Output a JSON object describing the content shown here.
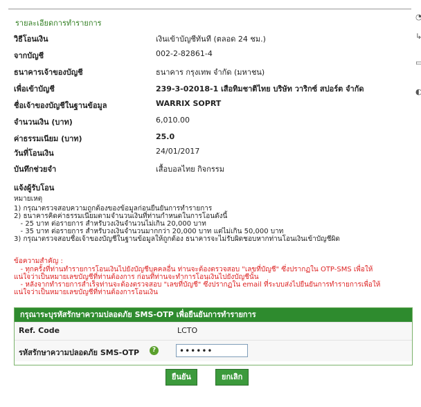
{
  "section_title": "รายละเอียดการทำรายการ",
  "rows": [
    {
      "label": "วิธีโอนเงิน",
      "value": "เงินเข้าบัญชีทันที (ตลอด 24 ชม.)",
      "bold": false
    },
    {
      "label": "จากบัญชี",
      "value": "002-2-82861-4",
      "bold": false
    },
    {
      "label": "ธนาคารเจ้าของบัญชี",
      "value": "ธนาคาร กรุงเทพ จำกัด (มหาชน)",
      "bold": false
    },
    {
      "label": "เพื่อเข้าบัญชี",
      "value": "239-3-02018-1 เสือทิมชาติไทย บริษัท วาริกซ์ สปอร์ต จำกัด",
      "bold": true
    },
    {
      "label": "ชื่อเจ้าของบัญชีในฐานข้อมูล",
      "value": "WARRIX SOPRT",
      "bold": true
    },
    {
      "label": "จำนวนเงิน (บาท)",
      "value": "6,010.00",
      "bold": false
    },
    {
      "label": "ค่าธรรมเนียม (บาท)",
      "value": "25.0",
      "bold": true
    },
    {
      "label": "วันที่โอนเงิน",
      "value": "24/01/2017",
      "bold": false
    },
    {
      "label": "บันทึกช่วยจำ",
      "value": "เสื้อบอลไทย กิจกรรม",
      "bold": false
    },
    {
      "label": "แจ้งผู้รับโอน",
      "value": "",
      "bold": false
    }
  ],
  "notes_title": "หมายเหตุ",
  "notes": [
    "1) กรุณาตรวจสอบความถูกต้องของข้อมูลก่อนยืนยันการทำรายการ",
    "2) ธนาคารคิดค่าธรรมเนียมตามจำนวนเงินที่ท่านกำหนดในการโอนดังนี้",
    "   - 25 บาท ต่อรายการ สำหรับวงเงินจำนวนไม่เกิน 20,000 บาท",
    "   - 35 บาท ต่อรายการ สำหรับวงเงินจำนวนมากกว่า 20,000 บาท แต่ไม่เกิน 50,000 บาท",
    "3) กรุณาตรวจสอบชื่อเจ้าของบัญชีในฐานข้อมูลให้ถูกต้อง ธนาคารจะไม่รับผิดชอบหากท่านโอนเงินเข้าบัญชีผิด"
  ],
  "important_title": "ข้อความสำคัญ :",
  "important": [
    "   - ทุกครั้งที่ท่านทำรายการโอนเงินไปยังบัญชีบุคคลอื่น ท่านจะต้องตรวจสอบ \"เลขที่บัญชี\" ซึ่งปรากฏใน OTP-SMS เพื่อให้",
    "แน่ใจว่าเป็นหมายเลขบัญชีที่ท่านต้องการ ก่อนที่ท่านจะทำการโอนเงินไปยังบัญชีนั้น",
    "   - หลังจากทำรายการสำเร็จท่านจะต้องตรวจสอบ \"เลขที่บัญชี\" ซึ่งปรากฏใน email ที่ระบบส่งไปยืนยันการทำรายการเพื่อให้",
    "แน่ใจว่าเป็นหมายเลขบัญชีที่ท่านต้องการโอนเงิน"
  ],
  "otp": {
    "header": "กรุณาระบุรหัสรักษาความปลอดภัย SMS-OTP เพื่อยืนยันการทำรายการ",
    "ref_label": "Ref. Code",
    "ref_value": "LCTO",
    "otp_label": "รหัสรักษาความปลอดภัย SMS-OTP",
    "otp_value": "••••••"
  },
  "buttons": {
    "confirm": "ยืนยัน",
    "cancel": "ยกเลิก"
  },
  "colors": {
    "header_green": "#2e8b2e",
    "title_green": "#2f7d1f",
    "warning_red": "#dd2222"
  }
}
